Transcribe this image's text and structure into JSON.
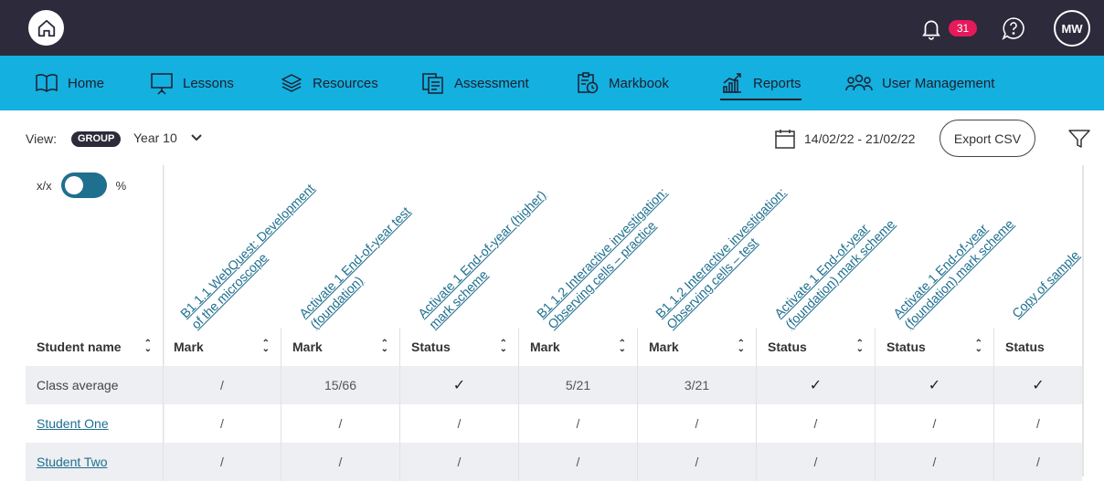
{
  "topbar": {
    "notification_count": "31",
    "user_initials": "MW"
  },
  "nav": {
    "items": [
      {
        "label": "Home",
        "icon": "book-icon"
      },
      {
        "label": "Lessons",
        "icon": "presentation-icon"
      },
      {
        "label": "Resources",
        "icon": "layers-icon"
      },
      {
        "label": "Assessment",
        "icon": "clipboard-icon"
      },
      {
        "label": "Markbook",
        "icon": "clipboard-clock-icon"
      },
      {
        "label": "Reports",
        "icon": "bar-chart-icon",
        "active": true
      },
      {
        "label": "User Management",
        "icon": "users-icon"
      }
    ]
  },
  "viewbar": {
    "view_label": "View:",
    "group_badge": "GROUP",
    "selected_group": "Year 10",
    "date_range": "14/02/22 - 21/02/22",
    "export_label": "Export CSV"
  },
  "toggle": {
    "left_label": "x/x",
    "right_label": "%"
  },
  "table": {
    "columns": [
      {
        "title": "B1 1.1 WebQuest: Development of the microscope",
        "title_lines": [
          "B1 1.1 WebQuest: Development",
          "of the microscope"
        ],
        "header": "Mark"
      },
      {
        "title": "Activate 1 End-of-year test (foundation)",
        "title_lines": [
          "Activate 1 End-of-year test",
          "(foundation)"
        ],
        "header": "Mark"
      },
      {
        "title": "Activate 1 End-of-year (higher) mark scheme",
        "title_lines": [
          "Activate 1 End-of-year (higher)",
          "mark scheme"
        ],
        "header": "Status"
      },
      {
        "title": "B1 1.2 Interactive investigation: Observing cells – practice",
        "title_lines": [
          "B1 1.2 Interactive investigation:",
          "Observing cells – practice"
        ],
        "header": "Mark"
      },
      {
        "title": "B1 1.2 Interactive investigation: Observing cells – test",
        "title_lines": [
          "B1 1.2 Interactive investigation:",
          "Observing cells – test"
        ],
        "header": "Mark"
      },
      {
        "title": "Activate 1 End-of-year (foundation) mark scheme",
        "title_lines": [
          "Activate 1 End-of-year",
          "(foundation) mark scheme"
        ],
        "header": "Status"
      },
      {
        "title": "Activate 1 End-of-year (foundation) mark scheme",
        "title_lines": [
          "Activate 1 End-of-year",
          "(foundation) mark scheme"
        ],
        "header": "Status"
      },
      {
        "title": "Copy of sample",
        "title_lines": [
          "Copy of sample"
        ],
        "header": "Status"
      }
    ],
    "name_header": "Student name",
    "rows": [
      {
        "name": "Class average",
        "link": false,
        "cells": [
          "/",
          "15/66",
          "✓",
          "5/21",
          "3/21",
          "✓",
          "✓",
          "✓"
        ]
      },
      {
        "name": "Student One",
        "link": true,
        "cells": [
          "/",
          "/",
          "/",
          "/",
          "/",
          "/",
          "/",
          "/"
        ]
      },
      {
        "name": "Student Two",
        "link": true,
        "cells": [
          "/",
          "/",
          "/",
          "/",
          "/",
          "/",
          "/",
          "/"
        ]
      }
    ]
  }
}
